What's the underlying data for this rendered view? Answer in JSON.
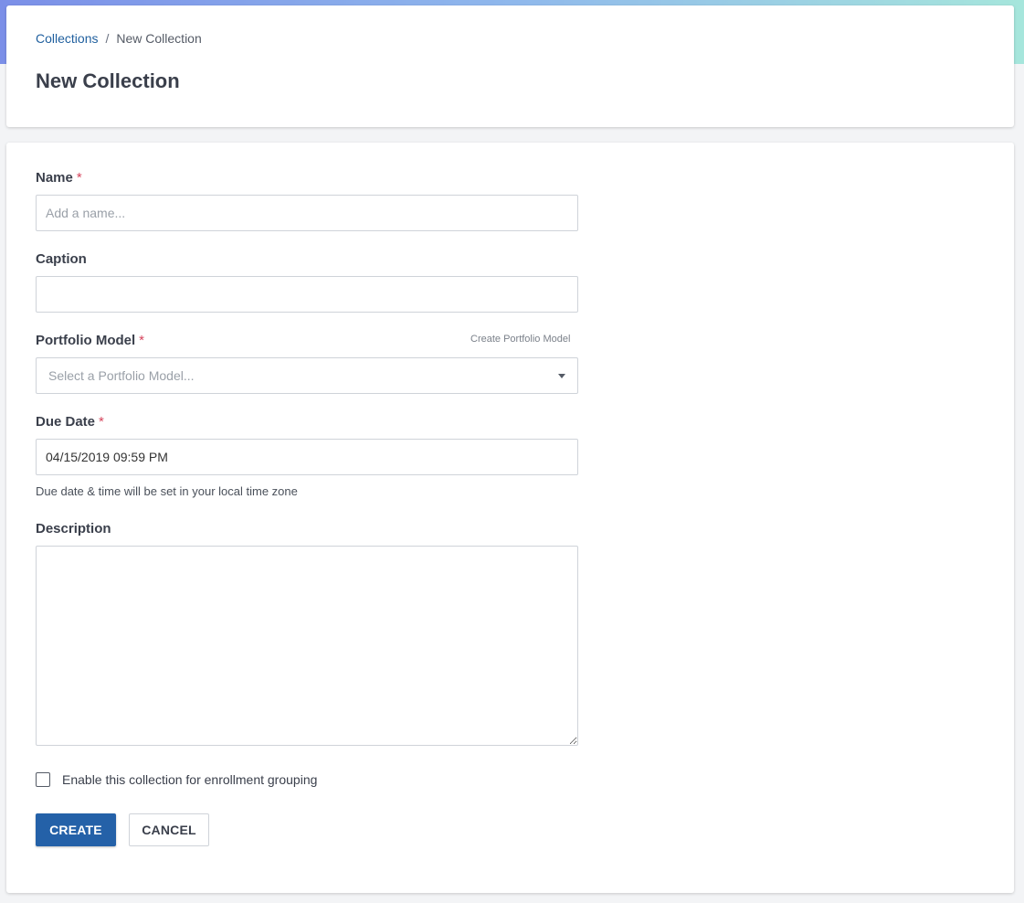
{
  "breadcrumb": {
    "parent": "Collections",
    "separator": "/",
    "current": "New Collection"
  },
  "page_title": "New Collection",
  "form": {
    "name": {
      "label": "Name",
      "required_mark": "*",
      "placeholder": "Add a name...",
      "value": ""
    },
    "caption": {
      "label": "Caption",
      "value": ""
    },
    "portfolio_model": {
      "label": "Portfolio Model",
      "required_mark": "*",
      "placeholder": "Select a Portfolio Model...",
      "create_link": "Create Portfolio Model"
    },
    "due_date": {
      "label": "Due Date",
      "required_mark": "*",
      "value": "04/15/2019 09:59 PM",
      "hint": "Due date & time will be set in your local time zone"
    },
    "description": {
      "label": "Description",
      "value": ""
    },
    "enrollment_checkbox": {
      "label": "Enable this collection for enrollment grouping",
      "checked": false
    },
    "buttons": {
      "create": "CREATE",
      "cancel": "CANCEL"
    }
  },
  "colors": {
    "primary": "#2461a8",
    "link": "#1f5f9e",
    "required": "#d6455d"
  }
}
